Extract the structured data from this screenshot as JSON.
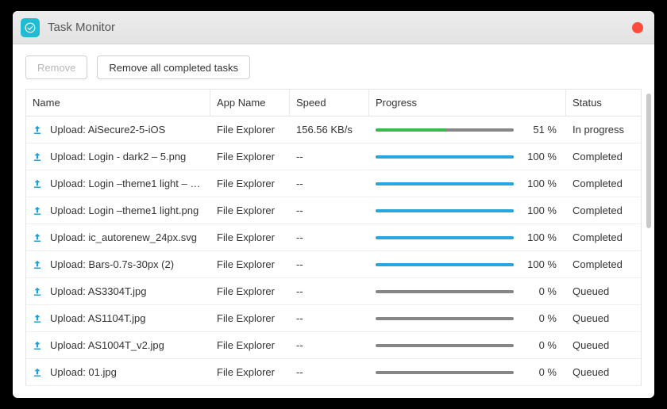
{
  "window": {
    "title": "Task Monitor"
  },
  "toolbar": {
    "remove_label": "Remove",
    "remove_all_label": "Remove all completed tasks"
  },
  "columns": {
    "name": "Name",
    "app": "App Name",
    "speed": "Speed",
    "progress": "Progress",
    "status": "Status"
  },
  "rows": [
    {
      "name": "Upload: AiSecure2-5-iOS",
      "app": "File Explorer",
      "speed": "156.56 KB/s",
      "pct": 51,
      "pct_label": "51 %",
      "status": "In progress",
      "active": true
    },
    {
      "name": "Upload: Login - dark2 – 5.png",
      "app": "File Explorer",
      "speed": "--",
      "pct": 100,
      "pct_label": "100 %",
      "status": "Completed",
      "active": false
    },
    {
      "name": "Upload: Login –theme1 light – 1....",
      "app": "File Explorer",
      "speed": "--",
      "pct": 100,
      "pct_label": "100 %",
      "status": "Completed",
      "active": false
    },
    {
      "name": "Upload: Login –theme1 light.png",
      "app": "File Explorer",
      "speed": "--",
      "pct": 100,
      "pct_label": "100 %",
      "status": "Completed",
      "active": false
    },
    {
      "name": "Upload: ic_autorenew_24px.svg",
      "app": "File Explorer",
      "speed": "--",
      "pct": 100,
      "pct_label": "100 %",
      "status": "Completed",
      "active": false
    },
    {
      "name": "Upload: Bars-0.7s-30px (2)",
      "app": "File Explorer",
      "speed": "--",
      "pct": 100,
      "pct_label": "100 %",
      "status": "Completed",
      "active": false
    },
    {
      "name": "Upload: AS3304T.jpg",
      "app": "File Explorer",
      "speed": "--",
      "pct": 0,
      "pct_label": "0 %",
      "status": "Queued",
      "active": false
    },
    {
      "name": "Upload: AS1104T.jpg",
      "app": "File Explorer",
      "speed": "--",
      "pct": 0,
      "pct_label": "0 %",
      "status": "Queued",
      "active": false
    },
    {
      "name": "Upload: AS1004T_v2.jpg",
      "app": "File Explorer",
      "speed": "--",
      "pct": 0,
      "pct_label": "0 %",
      "status": "Queued",
      "active": false
    },
    {
      "name": "Upload: 01.jpg",
      "app": "File Explorer",
      "speed": "--",
      "pct": 0,
      "pct_label": "0 %",
      "status": "Queued",
      "active": false
    }
  ]
}
